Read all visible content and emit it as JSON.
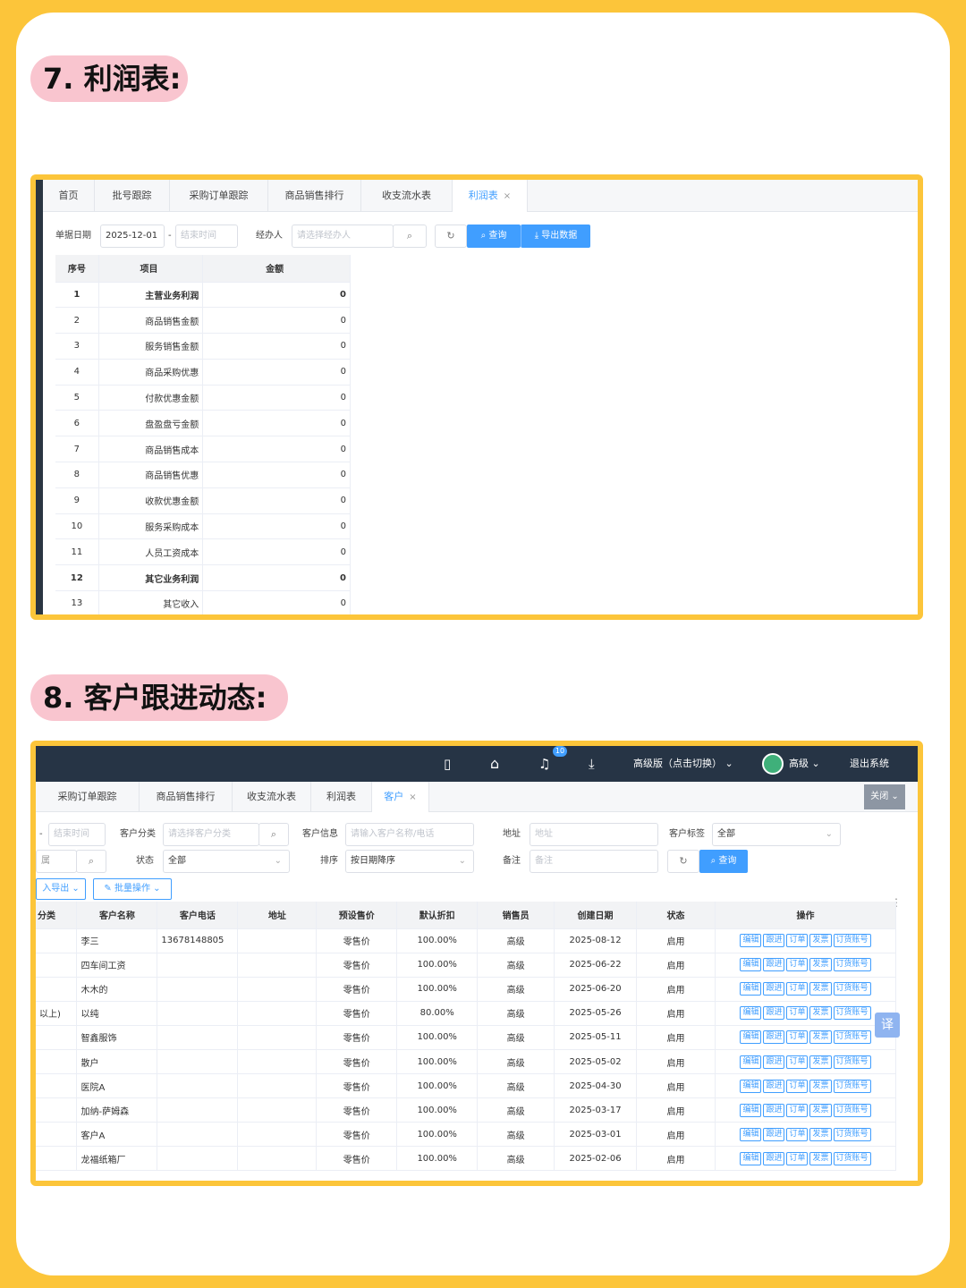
{
  "section1": {
    "heading": "7. 利润表:",
    "tabs": [
      {
        "label": "首页"
      },
      {
        "label": "批号跟踪"
      },
      {
        "label": "采购订单跟踪"
      },
      {
        "label": "商品销售排行"
      },
      {
        "label": "收支流水表"
      },
      {
        "label": "利润表",
        "close": "×"
      }
    ],
    "filters": {
      "date_label": "单据日期",
      "start_date": "2025-12-01",
      "dash": "-",
      "end_placeholder": "结束时间",
      "handler_label": "经办人",
      "handler_placeholder": "请选择经办人",
      "query_label": "查询",
      "export_label": "导出数据"
    },
    "table": {
      "headers": [
        "序号",
        "项目",
        "金额"
      ],
      "rows": [
        {
          "no": "1",
          "item": "主营业务利润",
          "amount": "0",
          "bold": true
        },
        {
          "no": "2",
          "item": "商品销售金额",
          "amount": "0"
        },
        {
          "no": "3",
          "item": "服务销售金额",
          "amount": "0"
        },
        {
          "no": "4",
          "item": "商品采购优惠",
          "amount": "0"
        },
        {
          "no": "5",
          "item": "付款优惠金额",
          "amount": "0"
        },
        {
          "no": "6",
          "item": "盘盈盘亏金额",
          "amount": "0"
        },
        {
          "no": "7",
          "item": "商品销售成本",
          "amount": "0"
        },
        {
          "no": "8",
          "item": "商品销售优惠",
          "amount": "0"
        },
        {
          "no": "9",
          "item": "收款优惠金额",
          "amount": "0"
        },
        {
          "no": "10",
          "item": "服务采购成本",
          "amount": "0"
        },
        {
          "no": "11",
          "item": "人员工资成本",
          "amount": "0"
        },
        {
          "no": "12",
          "item": "其它业务利润",
          "amount": "0",
          "bold": true
        },
        {
          "no": "13",
          "item": "其它收入",
          "amount": "0"
        }
      ]
    }
  },
  "section2": {
    "heading": "8. 客户跟进动态:",
    "topbar": {
      "badge": "10",
      "version": "高级版（点击切换）",
      "user": "高级",
      "logout": "退出系统"
    },
    "tabs": [
      {
        "label": "采购订单跟踪"
      },
      {
        "label": "商品销售排行"
      },
      {
        "label": "收支流水表"
      },
      {
        "label": "利润表"
      },
      {
        "label": "客户",
        "close": "×"
      }
    ],
    "close_label": "关闭",
    "filters": {
      "dash": "-",
      "end_placeholder": "结束时间",
      "category_label": "客户分类",
      "category_placeholder": "请选择客户分类",
      "info_label": "客户信息",
      "info_placeholder": "请输入客户名称/电话",
      "address_label": "地址",
      "address_placeholder": "地址",
      "tag_label": "客户标签",
      "tag_value": "全部",
      "status_label": "状态",
      "status_value": "全部",
      "sort_label": "排序",
      "sort_value": "按日期降序",
      "remark_label": "备注",
      "remark_placeholder": "备注",
      "query_label": "查询",
      "partial_left": "属"
    },
    "actions": {
      "export": "入导出",
      "batch": "批量操作"
    },
    "table": {
      "headers": [
        "分类",
        "客户名称",
        "客户电话",
        "地址",
        "预设售价",
        "默认折扣",
        "销售员",
        "创建日期",
        "状态",
        "操作"
      ],
      "op_buttons": [
        "编辑",
        "跟进",
        "订单",
        "发票",
        "订货账号"
      ],
      "rows": [
        {
          "category": "",
          "name": "李三",
          "phone": "13678148805",
          "price": "零售价",
          "discount": "100.00%",
          "sales": "高级",
          "date": "2025-08-12",
          "status": "启用"
        },
        {
          "category": "",
          "name": "四车间工资",
          "phone": "",
          "price": "零售价",
          "discount": "100.00%",
          "sales": "高级",
          "date": "2025-06-22",
          "status": "启用"
        },
        {
          "category": "",
          "name": "木木的",
          "phone": "",
          "price": "零售价",
          "discount": "100.00%",
          "sales": "高级",
          "date": "2025-06-20",
          "status": "启用"
        },
        {
          "category": "以上)",
          "name": "以纯",
          "phone": "",
          "price": "零售价",
          "discount": "80.00%",
          "sales": "高级",
          "date": "2025-05-26",
          "status": "启用"
        },
        {
          "category": "",
          "name": "智鑫服饰",
          "phone": "",
          "price": "零售价",
          "discount": "100.00%",
          "sales": "高级",
          "date": "2025-05-11",
          "status": "启用"
        },
        {
          "category": "",
          "name": "散户",
          "phone": "",
          "price": "零售价",
          "discount": "100.00%",
          "sales": "高级",
          "date": "2025-05-02",
          "status": "启用"
        },
        {
          "category": "",
          "name": "医院A",
          "phone": "",
          "price": "零售价",
          "discount": "100.00%",
          "sales": "高级",
          "date": "2025-04-30",
          "status": "启用"
        },
        {
          "category": "",
          "name": "加纳-萨姆森",
          "phone": "",
          "price": "零售价",
          "discount": "100.00%",
          "sales": "高级",
          "date": "2025-03-17",
          "status": "启用"
        },
        {
          "category": "",
          "name": "客户A",
          "phone": "",
          "price": "零售价",
          "discount": "100.00%",
          "sales": "高级",
          "date": "2025-03-01",
          "status": "启用"
        },
        {
          "category": "",
          "name": "龙福纸箱厂",
          "phone": "",
          "price": "零售价",
          "discount": "100.00%",
          "sales": "高级",
          "date": "2025-02-06",
          "status": "启用"
        }
      ]
    },
    "translate_glyph": "译"
  },
  "colors": {
    "background": "#fcc53a",
    "heading_pill": "#f9c5cf",
    "primary": "#409eff",
    "topbar": "#263445"
  }
}
